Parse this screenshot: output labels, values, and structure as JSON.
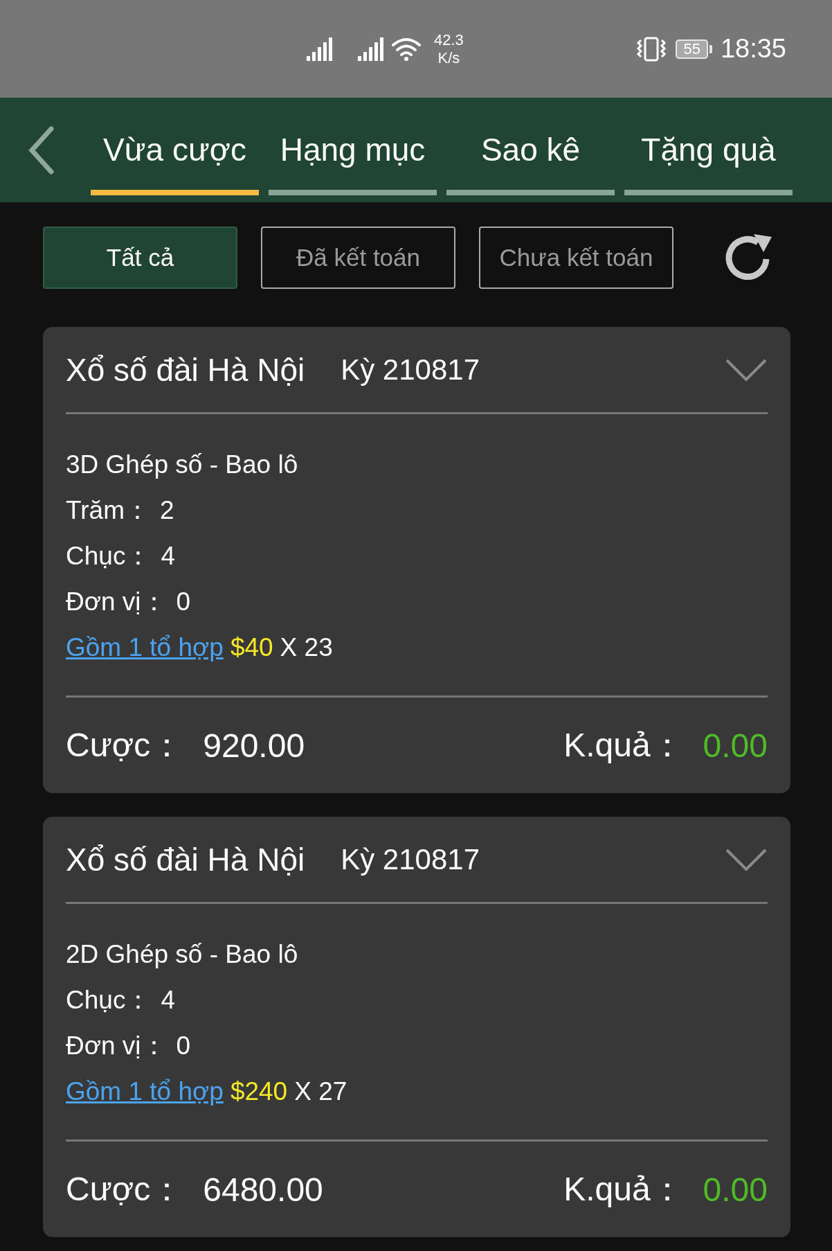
{
  "status_bar": {
    "speed_value": "42.3",
    "speed_unit": "K/s",
    "battery": "55",
    "time": "18:35"
  },
  "tabs": [
    {
      "label": "Vừa cược",
      "selected": true
    },
    {
      "label": "Hạng mục",
      "selected": false
    },
    {
      "label": "Sao kê",
      "selected": false
    },
    {
      "label": "Tặng quà",
      "selected": false
    }
  ],
  "filters": [
    {
      "label": "Tất cả",
      "selected": true
    },
    {
      "label": "Đã kết toán",
      "selected": false
    },
    {
      "label": "Chưa kết toán",
      "selected": false
    }
  ],
  "bets": [
    {
      "lottery": "Xổ số đài Hà Nội",
      "period": "Kỳ 210817",
      "bet_type": "3D Ghép số - Bao lô",
      "fields": [
        {
          "label": "Trăm：",
          "value": "2"
        },
        {
          "label": "Chục：",
          "value": "4"
        },
        {
          "label": "Đơn vị：",
          "value": "0"
        }
      ],
      "combo_link": "Gồm 1 tổ hợp",
      "unit_amount": "$40",
      "multiplier": "X 23",
      "stake_label": "Cược：",
      "stake": "920.00",
      "result_label": "K.quả：",
      "result": "0.00"
    },
    {
      "lottery": "Xổ số đài Hà Nội",
      "period": "Kỳ 210817",
      "bet_type": "2D Ghép số - Bao lô",
      "fields": [
        {
          "label": "Chục：",
          "value": "4"
        },
        {
          "label": "Đơn vị：",
          "value": "0"
        }
      ],
      "combo_link": "Gồm 1 tổ hợp",
      "unit_amount": "$240",
      "multiplier": "X 27",
      "stake_label": "Cược：",
      "stake": "6480.00",
      "result_label": "K.quả：",
      "result": "0.00"
    }
  ]
}
